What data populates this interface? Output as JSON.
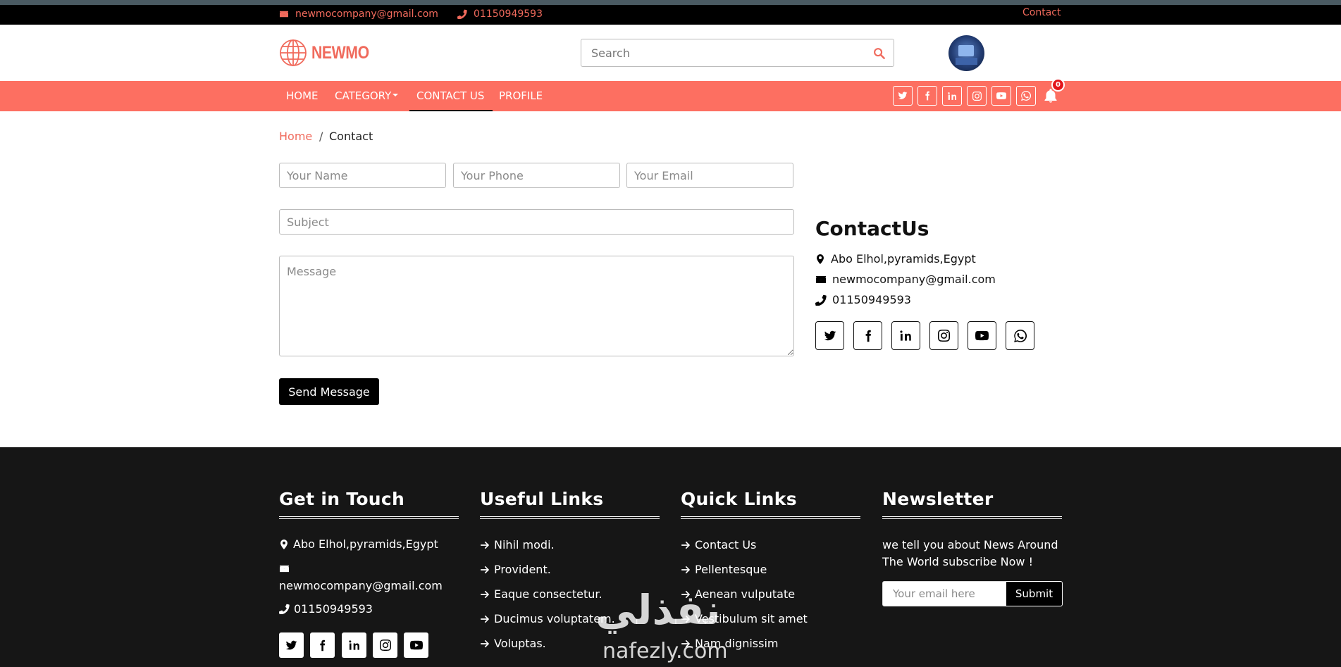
{
  "topbar": {
    "email": "newmocompany@gmail.com",
    "phone": "01150949593",
    "contact_link": "Contact"
  },
  "header": {
    "logo_text": "NEWMO",
    "search_placeholder": "Search"
  },
  "nav": {
    "items": [
      {
        "label": "HOME"
      },
      {
        "label": "CATEGORY"
      },
      {
        "label": "CONTACT US"
      },
      {
        "label": "PROFILE"
      }
    ],
    "active": "CONTACT US",
    "notification_count": "0"
  },
  "breadcrumb": {
    "home": "Home",
    "separator": "/",
    "current": "Contact"
  },
  "form": {
    "name_placeholder": "Your Name",
    "phone_placeholder": "Your Phone",
    "email_placeholder": "Your Email",
    "subject_placeholder": "Subject",
    "message_placeholder": "Message",
    "submit_label": "Send Message"
  },
  "contact_info": {
    "title": "ContactUs",
    "address": "Abo Elhol,pyramids,Egypt",
    "email": "newmocompany@gmail.com",
    "phone": "01150949593"
  },
  "footer": {
    "get_in_touch": {
      "title": "Get in Touch",
      "address": "Abo Elhol,pyramids,Egypt",
      "email": "newmocompany@gmail.com",
      "phone": "01150949593"
    },
    "useful_links": {
      "title": "Useful Links",
      "items": [
        "Nihil modi.",
        "Provident.",
        "Eaque consectetur.",
        "Ducimus voluptatem.",
        "Voluptas."
      ]
    },
    "quick_links": {
      "title": "Quick Links",
      "items": [
        "Contact Us",
        "Pellentesque",
        "Aenean vulputate",
        "Vestibulum sit amet",
        "Nam dignissim"
      ]
    },
    "newsletter": {
      "title": "Newsletter",
      "text": "we tell you about News Around The World subscribe Now !",
      "placeholder": "Your email here",
      "button": "Submit"
    }
  },
  "watermark": {
    "arabic": "نفذلي",
    "latin": "nafezly.com"
  },
  "colors": {
    "accent": "#fd6f61",
    "topbar_text": "#f06a5c",
    "dark": "#000000",
    "footer_bg": "#161616",
    "badge": "#e3151a"
  },
  "icons": {
    "social": [
      "twitter-icon",
      "facebook-icon",
      "linkedin-icon",
      "instagram-icon",
      "youtube-icon",
      "whatsapp-icon"
    ],
    "misc": [
      "envelope-icon",
      "phone-icon",
      "map-marker-icon",
      "search-icon",
      "bell-icon",
      "globe-logo-icon",
      "arrow-right-icon"
    ]
  }
}
